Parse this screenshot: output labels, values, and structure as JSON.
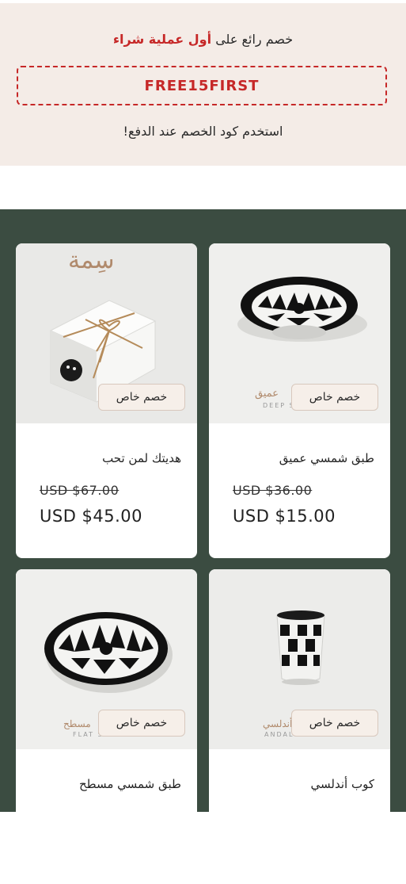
{
  "promo": {
    "headline_before": "خصم رائع على",
    "headline_accent": "أول عملية شراء",
    "coupon_code": "FREE15FIRST",
    "subline": "استخدم كود الخصم عند الدفع!"
  },
  "accent_color": "#c62828",
  "grid_background": "#3b4c41",
  "products": [
    {
      "badge": "خصم خاص",
      "title": "طبق شمسي عميق",
      "old_price": "USD $36.00",
      "new_price": "USD $15.00",
      "brand_script": "عميق",
      "brand_sub": "DEEP S"
    },
    {
      "badge": "خصم خاص",
      "title": "هديتك لمن تحب",
      "old_price": "USD $67.00",
      "new_price": "USD $45.00",
      "brand_script": "سِمة"
    },
    {
      "badge": "خصم خاص",
      "title": "كوب أندلسي",
      "brand_script": "أندلسي",
      "brand_sub": "ANDAL"
    },
    {
      "badge": "خصم خاص",
      "title": "طبق شمسي مسطح",
      "brand_script": "مسطح",
      "brand_sub": "FLAT S"
    }
  ]
}
